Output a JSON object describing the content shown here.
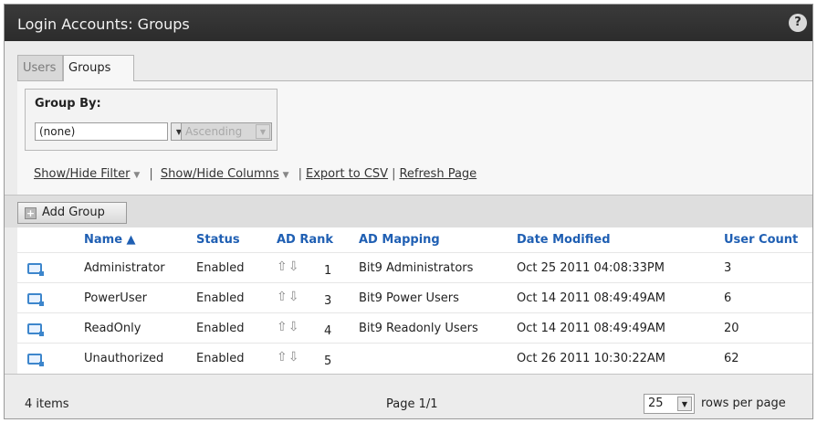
{
  "window": {
    "title": "Login Accounts: Groups",
    "help_label": "?"
  },
  "tabs": [
    {
      "label": "Users"
    },
    {
      "label": "Groups"
    }
  ],
  "group_by": {
    "label": "Group By:",
    "field_value": "(none)",
    "order_value": "Ascending"
  },
  "links": {
    "show_hide_filter": "Show/Hide Filter",
    "show_hide_columns": "Show/Hide Columns",
    "export_csv": "Export to CSV",
    "refresh_page": "Refresh Page"
  },
  "toolbar": {
    "add_group_label": "Add Group"
  },
  "table": {
    "headers": {
      "name": "Name ▲",
      "status": "Status",
      "ad_rank": "AD Rank",
      "ad_mapping": "AD Mapping",
      "date_modified": "Date Modified",
      "user_count": "User Count"
    },
    "rows": [
      {
        "name": "Administrator",
        "status": "Enabled",
        "rank": "1",
        "mapping": "Bit9 Administrators",
        "date": "Oct 25 2011 04:08:33PM",
        "count": "3"
      },
      {
        "name": "PowerUser",
        "status": "Enabled",
        "rank": "3",
        "mapping": "Bit9 Power Users",
        "date": "Oct 14 2011 08:49:49AM",
        "count": "6"
      },
      {
        "name": "ReadOnly",
        "status": "Enabled",
        "rank": "4",
        "mapping": "Bit9 Readonly Users",
        "date": "Oct 14 2011 08:49:49AM",
        "count": "20"
      },
      {
        "name": "Unauthorized",
        "status": "Enabled",
        "rank": "5",
        "mapping": "",
        "date": "Oct 26 2011 10:30:22AM",
        "count": "62"
      }
    ]
  },
  "footer": {
    "item_count": "4 items",
    "page_info": "Page 1/1",
    "rows_per_page_value": "25",
    "rows_per_page_label": "rows per page"
  },
  "icons": {
    "row_icon": "group-icon",
    "rank_up": "arrow-up-icon",
    "rank_down": "arrow-down-icon",
    "dropdown": "chevron-down-icon"
  }
}
